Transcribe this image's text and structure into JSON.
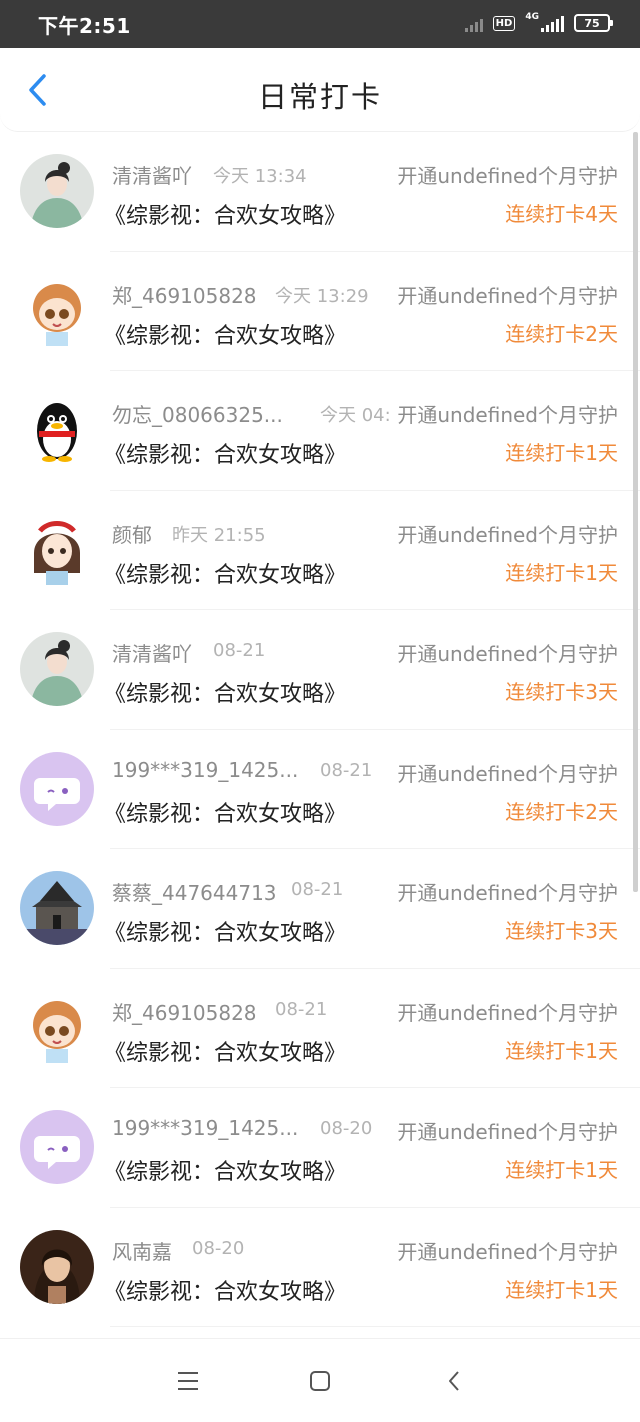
{
  "status_bar": {
    "time": "下午2:51",
    "hd": "HD",
    "network": "4G",
    "battery": "75"
  },
  "header": {
    "title": "日常打卡",
    "back_icon": "chevron-left-icon",
    "accent_color": "#2d8cf0"
  },
  "colors": {
    "streak": "#f08a3a",
    "muted_text": "#8c8c8c"
  },
  "list": [
    {
      "name": "清清酱吖",
      "time": "今天 13:34",
      "guard": "开通undefined个月守护",
      "book": "《综影视：合欢女攻略》",
      "streak": "连续打卡4天",
      "avatar": "avatar-woman-green"
    },
    {
      "name": "郑_469105828",
      "time": "今天 13:29",
      "guard": "开通undefined个月守护",
      "book": "《综影视：合欢女攻略》",
      "streak": "连续打卡2天",
      "avatar": "avatar-cartoon-boy"
    },
    {
      "name": "勿忘_08066325...",
      "time": "今天 04:",
      "guard": "开通undefined个月守护",
      "book": "《综影视：合欢女攻略》",
      "streak": "连续打卡1天",
      "avatar": "avatar-qq-penguin"
    },
    {
      "name": "颜郁",
      "time": "昨天 21:55",
      "guard": "开通undefined个月守护",
      "book": "《综影视：合欢女攻略》",
      "streak": "连续打卡1天",
      "avatar": "avatar-cartoon-girl"
    },
    {
      "name": "清清酱吖",
      "time": "08-21",
      "guard": "开通undefined个月守护",
      "book": "《综影视：合欢女攻略》",
      "streak": "连续打卡3天",
      "avatar": "avatar-woman-green"
    },
    {
      "name": "199***319_1425...",
      "time": "08-21",
      "guard": "开通undefined个月守护",
      "book": "《综影视：合欢女攻略》",
      "streak": "连续打卡2天",
      "avatar": "avatar-chat-bubble"
    },
    {
      "name": "蔡蔡_447644713",
      "time": "08-21",
      "guard": "开通undefined个月守护",
      "book": "《综影视：合欢女攻略》",
      "streak": "连续打卡3天",
      "avatar": "avatar-building"
    },
    {
      "name": "郑_469105828",
      "time": "08-21",
      "guard": "开通undefined个月守护",
      "book": "《综影视：合欢女攻略》",
      "streak": "连续打卡1天",
      "avatar": "avatar-cartoon-boy"
    },
    {
      "name": "199***319_1425...",
      "time": "08-20",
      "guard": "开通undefined个月守护",
      "book": "《综影视：合欢女攻略》",
      "streak": "连续打卡1天",
      "avatar": "avatar-chat-bubble"
    },
    {
      "name": "风南嘉",
      "time": "08-20",
      "guard": "开通undefined个月守护",
      "book": "《综影视：合欢女攻略》",
      "streak": "连续打卡1天",
      "avatar": "avatar-woman-portrait"
    }
  ],
  "nav_bar": {
    "menu_icon": "menu-icon",
    "home_icon": "home-square-icon",
    "back_icon": "back-triangle-icon"
  }
}
